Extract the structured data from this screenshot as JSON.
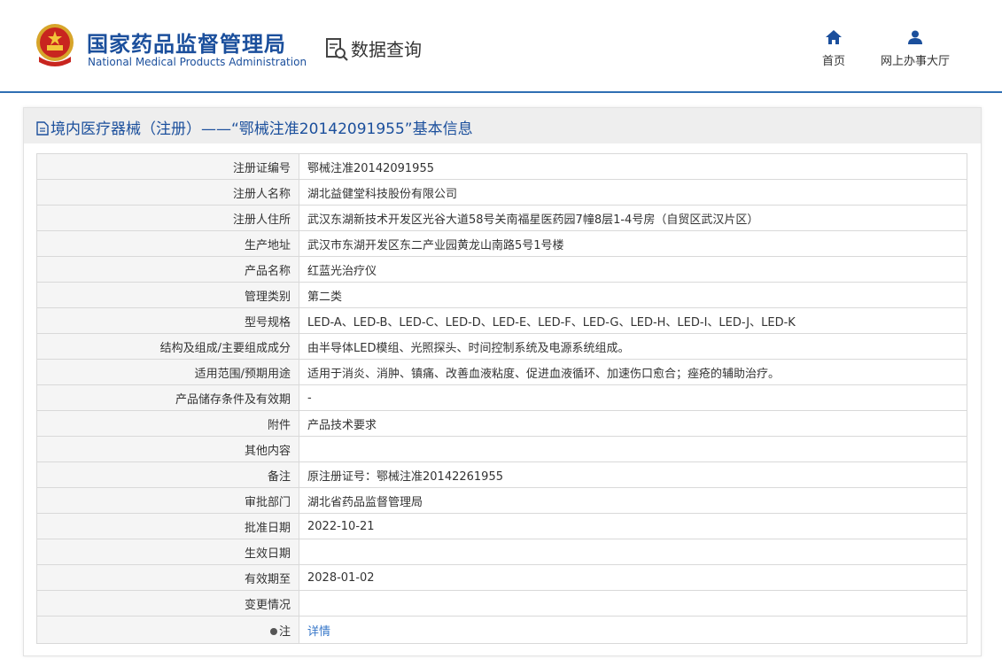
{
  "header": {
    "brand_cn": "国家药品监督管理局",
    "brand_en": "National Medical Products Administration",
    "section": "数据查询",
    "nav": [
      {
        "label": "首页",
        "icon": "home-icon"
      },
      {
        "label": "网上办事大厅",
        "icon": "user-icon"
      }
    ]
  },
  "panel": {
    "title": "境内医疗器械（注册）——“鄂械注准20142091955”基本信息"
  },
  "fields": [
    {
      "label": "注册证编号",
      "value": "鄂械注准20142091955"
    },
    {
      "label": "注册人名称",
      "value": "湖北益健堂科技股份有限公司"
    },
    {
      "label": "注册人住所",
      "value": "武汉东湖新技术开发区光谷大道58号关南福星医药园7幢8层1-4号房（自贸区武汉片区）"
    },
    {
      "label": "生产地址",
      "value": "武汉市东湖开发区东二产业园黄龙山南路5号1号楼"
    },
    {
      "label": "产品名称",
      "value": "红蓝光治疗仪"
    },
    {
      "label": "管理类别",
      "value": "第二类"
    },
    {
      "label": "型号规格",
      "value": "LED-A、LED-B、LED-C、LED-D、LED-E、LED-F、LED-G、LED-H、LED-I、LED-J、LED-K"
    },
    {
      "label": "结构及组成/主要组成成分",
      "value": "由半导体LED模组、光照探头、时间控制系统及电源系统组成。"
    },
    {
      "label": "适用范围/预期用途",
      "value": "适用于消炎、消肿、镇痛、改善血液粘度、促进血液循环、加速伤口愈合；痤疮的辅助治疗。"
    },
    {
      "label": "产品储存条件及有效期",
      "value": "-"
    },
    {
      "label": "附件",
      "value": "产品技术要求"
    },
    {
      "label": "其他内容",
      "value": ""
    },
    {
      "label": "备注",
      "value": "原注册证号：鄂械注准20142261955"
    },
    {
      "label": "审批部门",
      "value": "湖北省药品监督管理局"
    },
    {
      "label": "批准日期",
      "value": "2022-10-21"
    },
    {
      "label": "生效日期",
      "value": ""
    },
    {
      "label": "有效期至",
      "value": "2028-01-02"
    },
    {
      "label": "变更情况",
      "value": ""
    }
  ],
  "note_row": {
    "label": "注",
    "link": "详情"
  },
  "colors": {
    "brand": "#1b4f9c",
    "link": "#3777c9",
    "header_line": "#2f6fb3"
  }
}
